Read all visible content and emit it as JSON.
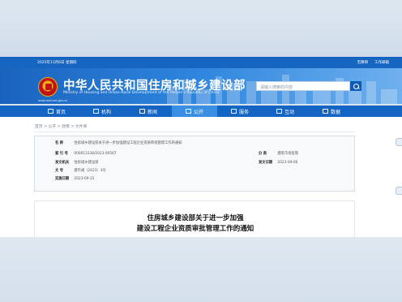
{
  "top_bar": {
    "date": "2025年11月6日 星期四",
    "barrier_free": "无障碍",
    "work_login": "工作邮箱"
  },
  "header": {
    "title": "中华人民共和国住房和城乡建设部",
    "subtitle": "Ministry of Housing and Urban-Rural Development of the People's Republic of China",
    "url": "www.mohurd.gov.cn",
    "search_placeholder": "请输入搜索的内容"
  },
  "nav": {
    "items": [
      {
        "label": "首页"
      },
      {
        "label": "机构"
      },
      {
        "label": "新闻"
      },
      {
        "label": "公开"
      },
      {
        "label": "服务"
      },
      {
        "label": "互动"
      },
      {
        "label": "数据"
      }
    ]
  },
  "breadcrumb": {
    "text": "首页 > 公开 > 政策 > 文件库"
  },
  "info": {
    "name_key": "名 称",
    "name_val": "住房城乡建设部关于进一步加强建设工程企业资质审批管理工作的通知",
    "index_key": "索 引 号",
    "index_val": "000013338/2023-00567",
    "category_key": "分 类",
    "category_val": "建筑市场监管",
    "issuer_key": "发文机关",
    "issuer_val": "住房城乡建设部",
    "date_key": "发文日期",
    "date_val": "2023-09-06",
    "docno_key": "文 号",
    "docno_val": "建市规〔2023〕3号",
    "impl_key": "实施日期",
    "impl_val": "2023-09-15"
  },
  "article": {
    "title_line1": "住房城乡建设部关于进一步加强",
    "title_line2": "建设工程企业资质审批管理工作的通知"
  }
}
